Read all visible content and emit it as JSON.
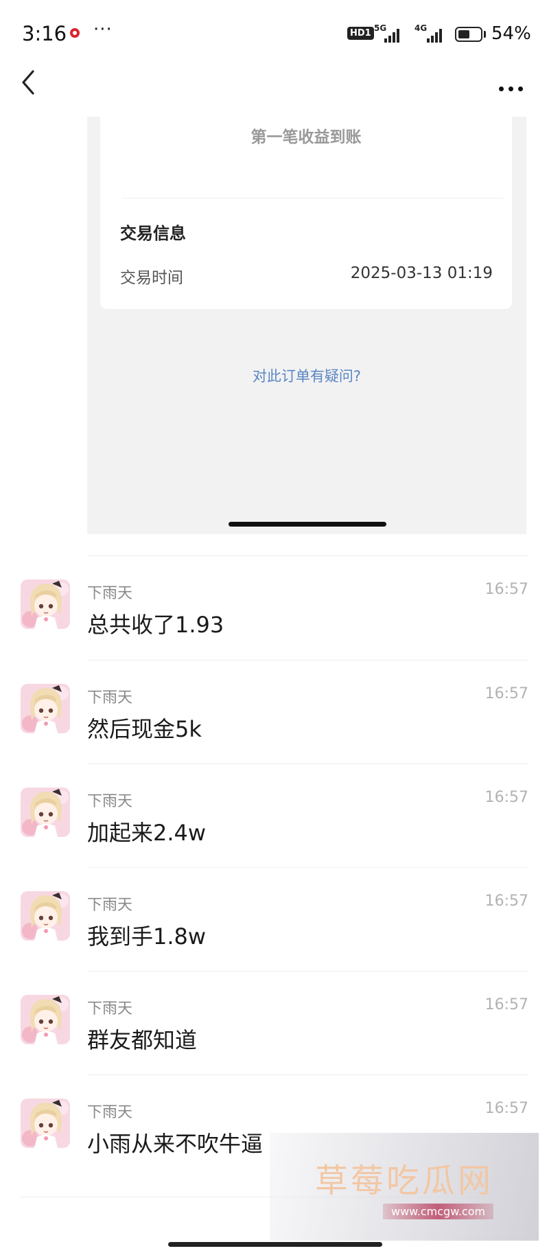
{
  "status_bar": {
    "time": "3:16",
    "more": "···",
    "hd_badge": "HD1",
    "net_1": "5G",
    "net_2": "4G",
    "battery_percent": 54,
    "battery_text": "54%"
  },
  "receipt": {
    "headline": "第一笔收益到账",
    "section_title": "交易信息",
    "trade_time_label": "交易时间",
    "trade_time_value": "2025-03-13 01:19",
    "question_link": "对此订单有疑问?"
  },
  "messages": [
    {
      "sender": "下雨天",
      "time": "16:57",
      "text": "总共收了1.93"
    },
    {
      "sender": "下雨天",
      "time": "16:57",
      "text": "然后现金5k"
    },
    {
      "sender": "下雨天",
      "time": "16:57",
      "text": "加起来2.4w"
    },
    {
      "sender": "下雨天",
      "time": "16:57",
      "text": "我到手1.8w"
    },
    {
      "sender": "下雨天",
      "time": "16:57",
      "text": "群友都知道"
    },
    {
      "sender": "下雨天",
      "time": "16:57",
      "text": "小雨从来不吹牛逼"
    }
  ],
  "watermark": {
    "title": "草莓吃瓜网",
    "url": "www.cmcgw.com"
  },
  "icons": {
    "back": "chevron-left-icon",
    "more": "more-horizontal-icon",
    "avatar": "anime-girl-avatar"
  }
}
